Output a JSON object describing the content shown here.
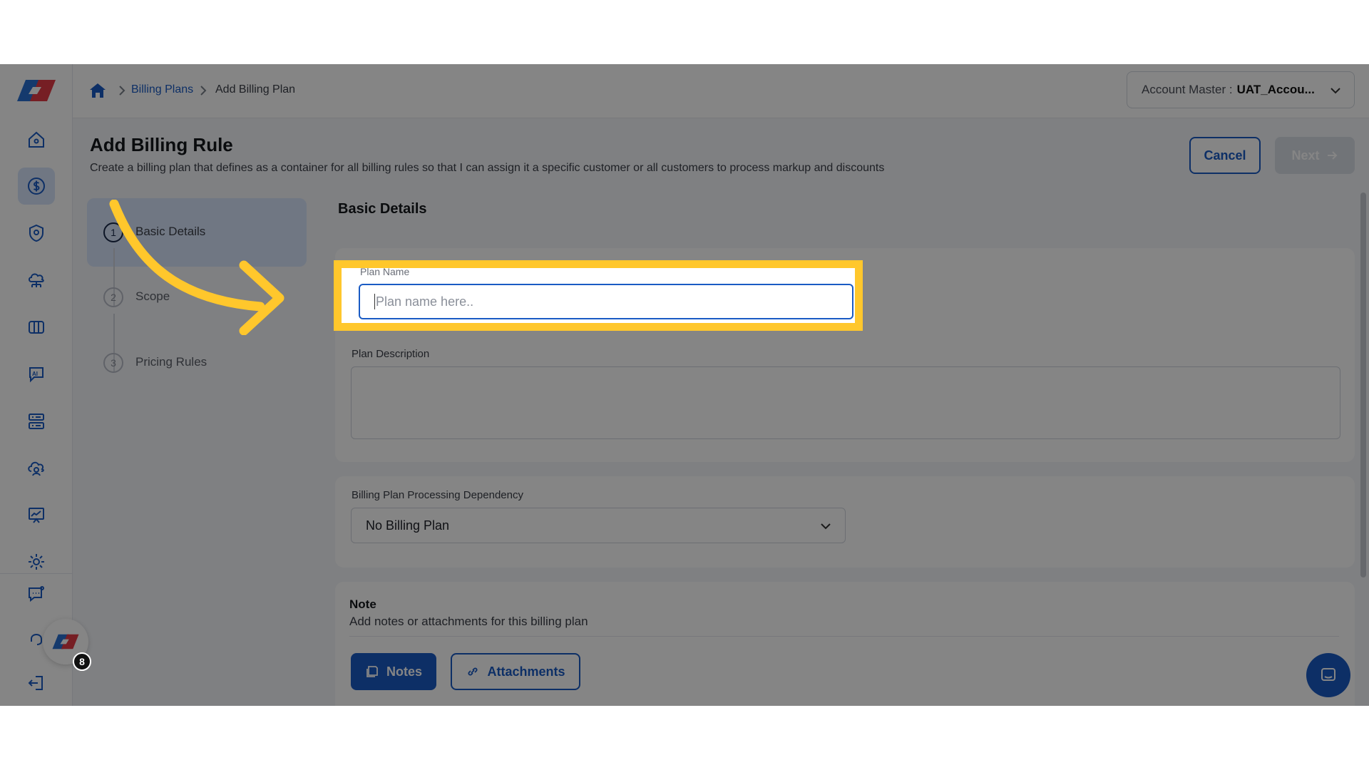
{
  "app": {
    "brand_colors": {
      "primary": "#1a5bc4",
      "highlight": "#ffc72c"
    }
  },
  "breadcrumb": {
    "items": [
      "Billing Plans",
      "Add Billing Plan"
    ]
  },
  "account": {
    "label": "Account Master :",
    "value": "UAT_Accou..."
  },
  "header": {
    "title": "Add Billing Rule",
    "subtitle": "Create a billing plan that defines as a container for all billing rules so that I can assign it a specific customer or all customers to process markup and discounts",
    "cancel_label": "Cancel",
    "next_label": "Next"
  },
  "steps": [
    {
      "num": "1",
      "label": "Basic Details",
      "active": true
    },
    {
      "num": "2",
      "label": "Scope",
      "active": false
    },
    {
      "num": "3",
      "label": "Pricing Rules",
      "active": false
    }
  ],
  "form": {
    "section_title": "Basic Details",
    "plan_name": {
      "label": "Plan Name",
      "placeholder": "Plan name here.."
    },
    "plan_description": {
      "label": "Plan Description",
      "value": ""
    },
    "dependency": {
      "label": "Billing Plan Processing Dependency",
      "value": "No Billing Plan"
    }
  },
  "note": {
    "title": "Note",
    "subtitle": "Add notes or attachments for this billing plan",
    "notes_label": "Notes",
    "attachments_label": "Attachments"
  },
  "floater": {
    "badge": "8"
  },
  "sidebar": {
    "icons": [
      "home-icon",
      "billing-icon",
      "shield-location-icon",
      "cloud-network-icon",
      "panel-icon",
      "ai-chat-icon",
      "server-icon",
      "cloud-user-icon",
      "presentation-chart-icon",
      "settings-gear-icon",
      "support-chat-icon",
      "support-agent-icon",
      "logout-icon"
    ]
  }
}
